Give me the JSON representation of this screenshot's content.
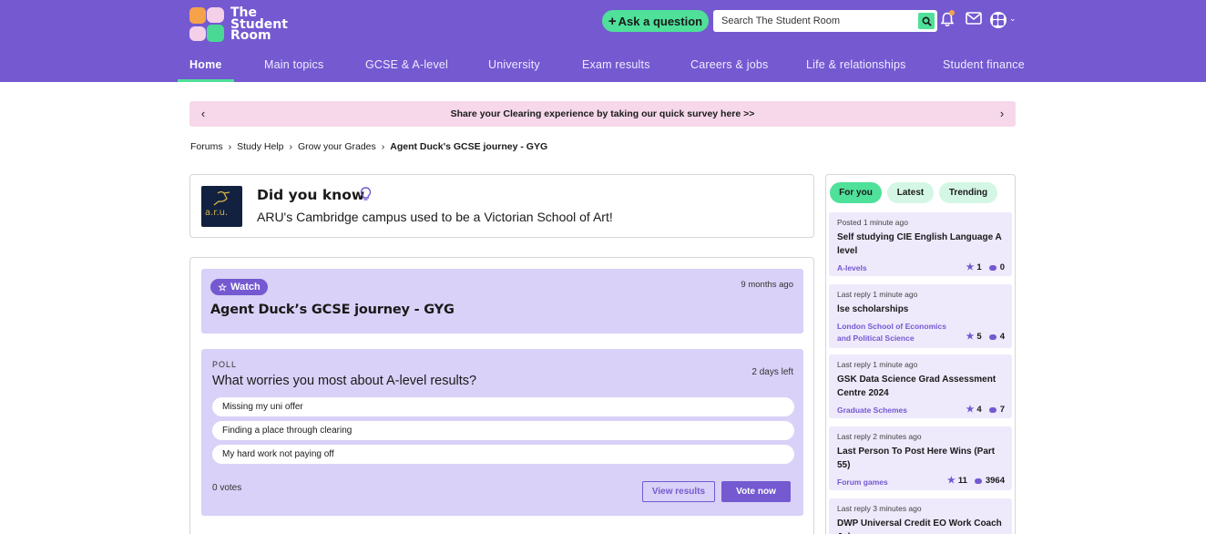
{
  "header": {
    "logo_text": [
      "The",
      "Student",
      "Room"
    ],
    "ask_label": "Ask a question",
    "search_placeholder": "Search The Student Room"
  },
  "nav": {
    "items": [
      "Home",
      "Main topics",
      "GCSE & A-level",
      "University",
      "Exam results",
      "Careers & jobs",
      "Life & relationships",
      "Student finance"
    ],
    "active": "Home"
  },
  "banner": {
    "text": "Share your Clearing experience by taking our quick survey here >>",
    "prev": "‹",
    "next": "›"
  },
  "breadcrumb": [
    "Forums",
    "Study Help",
    "Grow your Grades",
    "Agent Duck's GCSE journey - GYG"
  ],
  "did_you_know": {
    "title": "Did you know",
    "logo_text": "a.r.u.",
    "text": "ARU's Cambridge campus used to be a Victorian School of Art!"
  },
  "thread": {
    "watch_label": "Watch",
    "time": "9 months ago",
    "title": "Agent Duck’s GCSE journey - GYG"
  },
  "poll": {
    "label": "POLL",
    "question": "What worries you most about A-level results?",
    "time_left": "2 days left",
    "options": [
      "Missing my uni offer",
      "Finding a place through clearing",
      "My hard work not paying off"
    ],
    "votes": "0 votes",
    "view_label": "View results",
    "vote_label": "Vote now"
  },
  "sidebar": {
    "tabs": [
      "For you",
      "Latest",
      "Trending"
    ],
    "active_tab": "For you",
    "cards": [
      {
        "meta": "Posted 1 minute ago",
        "title": "Self studying CIE English Language A level",
        "category": "A-levels",
        "stars": "1",
        "replies": "0"
      },
      {
        "meta": "Last reply 1 minute ago",
        "title": "lse scholarships",
        "category": "London School of Economics and Political Science",
        "stars": "5",
        "replies": "4"
      },
      {
        "meta": "Last reply 1 minute ago",
        "title": "GSK Data Science Grad Assessment Centre 2024",
        "category": "Graduate Schemes",
        "stars": "4",
        "replies": "7"
      },
      {
        "meta": "Last reply 2 minutes ago",
        "title": "Last Person To Post Here Wins (Part 55)",
        "category": "Forum games",
        "stars": "11",
        "replies": "3964"
      },
      {
        "meta": "Last reply 3 minutes ago",
        "title": "DWP Universal Credit EO Work Coach Job",
        "category": "",
        "stars": "",
        "replies": ""
      }
    ]
  },
  "colors": {
    "brand_purple": "#7459d1",
    "accent_green": "#4fe09a",
    "banner_pink": "#f6d8ea",
    "panel_lavender": "#d9d1f7"
  }
}
